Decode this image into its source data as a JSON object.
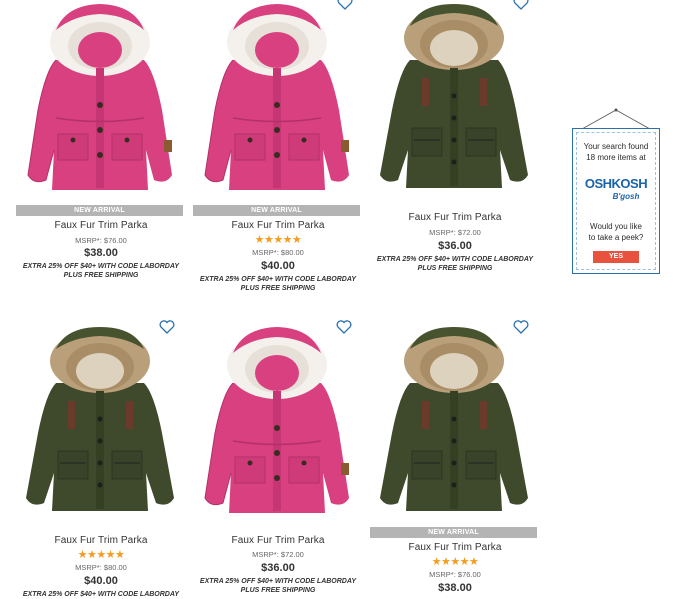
{
  "products": [
    {
      "variant": "pink",
      "badge": "NEW ARRIVAL",
      "title": "Faux Fur Trim Parka",
      "stars": "",
      "msrp": "MSRP*: $76.00",
      "price": "$38.00",
      "promo1": "EXTRA 25% OFF $40+ WITH CODE LABORDAY",
      "promo2": "PLUS FREE SHIPPING"
    },
    {
      "variant": "pink",
      "badge": "NEW ARRIVAL",
      "title": "Faux Fur Trim Parka",
      "stars": "★★★★★",
      "msrp": "MSRP*: $80.00",
      "price": "$40.00",
      "promo1": "EXTRA 25% OFF $40+ WITH CODE LABORDAY",
      "promo2": "PLUS FREE SHIPPING"
    },
    {
      "variant": "green",
      "badge": "",
      "title": "Faux Fur Trim Parka",
      "stars": "",
      "msrp": "MSRP*: $72.00",
      "price": "$36.00",
      "promo1": "EXTRA 25% OFF $40+ WITH CODE LABORDAY",
      "promo2": "PLUS FREE SHIPPING"
    },
    {
      "variant": "green",
      "badge": "",
      "title": "Faux Fur Trim Parka",
      "stars": "★★★★★",
      "msrp": "MSRP*: $80.00",
      "price": "$40.00",
      "promo1": "EXTRA 25% OFF $40+ WITH CODE LABORDAY",
      "promo2": ""
    },
    {
      "variant": "pink",
      "badge": "",
      "title": "Faux Fur Trim Parka",
      "stars": "",
      "msrp": "MSRP*: $72.00",
      "price": "$36.00",
      "promo1": "EXTRA 25% OFF $40+ WITH CODE LABORDAY",
      "promo2": "PLUS FREE SHIPPING"
    },
    {
      "variant": "green",
      "badge": "NEW ARRIVAL",
      "title": "Faux Fur Trim Parka",
      "stars": "★★★★★",
      "msrp": "MSRP*: $76.00",
      "price": "$38.00",
      "promo1": "",
      "promo2": ""
    }
  ],
  "ad": {
    "line1": "Your search found",
    "line2": "18 more items at",
    "logo_top": "OSHKOSH",
    "logo_bottom": "B'gosh",
    "line3": "Would you like",
    "line4": "to take a peek?",
    "button": "YES"
  },
  "icons": {
    "favorite": "heart-outline-icon"
  },
  "colors": {
    "accent_blue": "#2a6fb0",
    "star": "#f39c1f",
    "badge_bg": "#b4b4b4",
    "ad_button": "#e8533f"
  }
}
